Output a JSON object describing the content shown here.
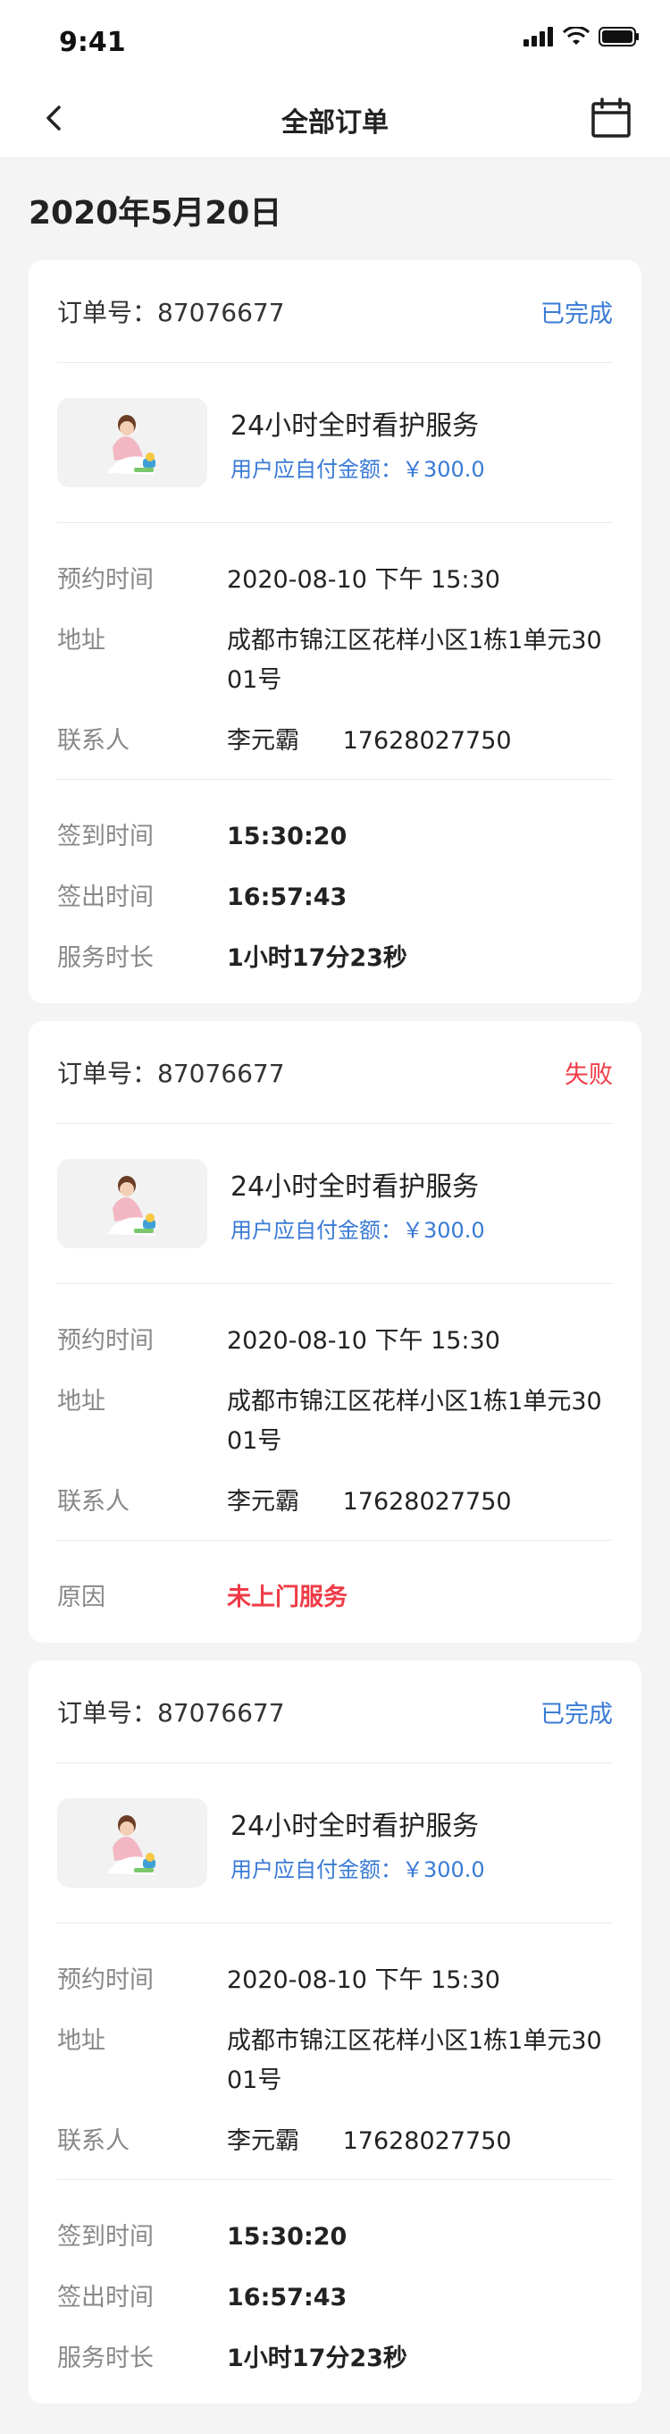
{
  "status_bar": {
    "time": "9:41"
  },
  "nav": {
    "title": "全部订单",
    "back_icon": "chevron-left-icon",
    "calendar_icon": "calendar-icon"
  },
  "date": "2020年5月20日",
  "labels": {
    "appointment": "预约时间",
    "address": "地址",
    "contact": "联系人",
    "checkin": "签到时间",
    "checkout": "签出时间",
    "duration": "服务时长",
    "reason": "原因"
  },
  "orders": [
    {
      "order_no": "订单号：87076677",
      "status": "已完成",
      "service_title": "24小时全时看护服务",
      "price": "用户应自付金额：￥300.0",
      "appointment": "2020-08-10 下午 15:30",
      "address": "成都市锦江区花样小区1栋1单元3001号",
      "contact_name": "李元霸",
      "contact_phone": "17628027750",
      "checkin": "15:30:20",
      "checkout": "16:57:43",
      "duration": "1小时17分23秒"
    },
    {
      "order_no": "订单号：87076677",
      "status": "失败",
      "service_title": "24小时全时看护服务",
      "price": "用户应自付金额：￥300.0",
      "appointment": "2020-08-10 下午 15:30",
      "address": "成都市锦江区花样小区1栋1单元3001号",
      "contact_name": "李元霸",
      "contact_phone": "17628027750",
      "reason": "未上门服务"
    },
    {
      "order_no": "订单号：87076677",
      "status": "已完成",
      "service_title": "24小时全时看护服务",
      "price": "用户应自付金额：￥300.0",
      "appointment": "2020-08-10 下午 15:30",
      "address": "成都市锦江区花样小区1栋1单元3001号",
      "contact_name": "李元霸",
      "contact_phone": "17628027750",
      "checkin": "15:30:20",
      "checkout": "16:57:43",
      "duration": "1小时17分23秒"
    }
  ]
}
